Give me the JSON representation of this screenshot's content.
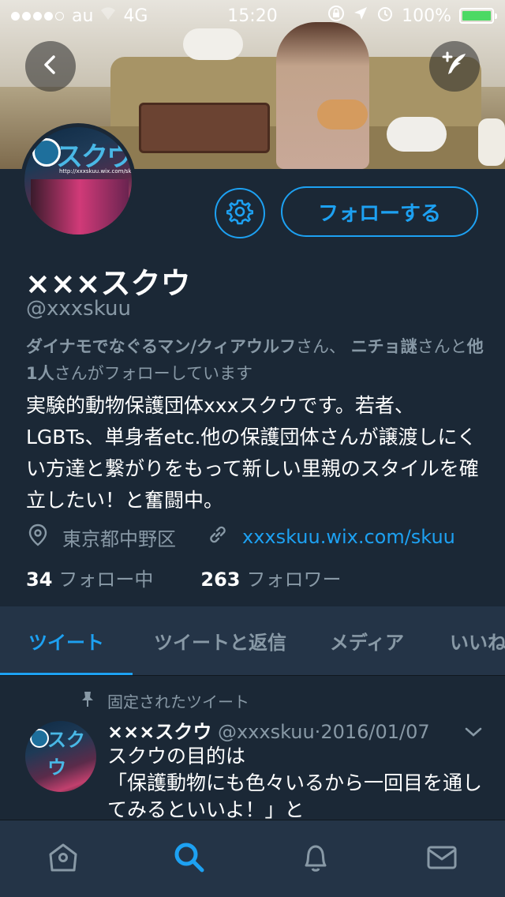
{
  "status_bar": {
    "carrier": "au",
    "network": "4G",
    "time": "15:20",
    "battery": "100%",
    "battery_level": 1.0
  },
  "header": {
    "back_icon": "chevron-left-icon",
    "compose_icon": "compose-tweet-icon"
  },
  "profile": {
    "name": "×××スクウ",
    "handle": "@xxxskuu",
    "settings_icon": "gear-icon",
    "follow_label": "フォローする",
    "followed_by": {
      "user1": "ダイナモでなぐるマン/クィアウルフ",
      "san1": "さん、",
      "user2": "ニチョ謎",
      "san2": "さんと",
      "others": "他1人",
      "suffix": "さんがフォローしています"
    },
    "bio": "実験的動物保護団体xxxスクウです。若者、LGBTs、単身者etc.他の保護団体さんが譲渡しにくい方達と繋がりをもって新しい里親のスタイルを確立したい！と奮闘中。",
    "location": "東京都中野区",
    "link": "xxxskuu.wix.com/skuu",
    "following_count": "34",
    "following_label": "フォロー中",
    "followers_count": "263",
    "followers_label": "フォロワー"
  },
  "avatar_text": {
    "logo": "スクウ",
    "url": "http://xxxskuu.wix.com/skuu"
  },
  "tabs": [
    {
      "label": "ツイート",
      "active": true
    },
    {
      "label": "ツイートと返信",
      "active": false
    },
    {
      "label": "メディア",
      "active": false
    },
    {
      "label": "いいね",
      "active": false
    }
  ],
  "tweet": {
    "pinned_label": "固定されたツイート",
    "name": "×××スクウ",
    "handle": "@xxxskuu",
    "separator": "·",
    "date": "2016/01/07",
    "text_line1": "スクウの目的は",
    "text_line2": "「保護動物にも色々いるから一回目を通してみるといいよ！」と"
  },
  "bottom_nav": [
    {
      "icon": "home-icon",
      "active": false
    },
    {
      "icon": "search-icon",
      "active": true
    },
    {
      "icon": "bell-icon",
      "active": false
    },
    {
      "icon": "mail-icon",
      "active": false
    }
  ],
  "colors": {
    "background": "#1b2836",
    "panel": "#243447",
    "accent": "#1da1f2",
    "secondary_text": "#8899a6"
  }
}
